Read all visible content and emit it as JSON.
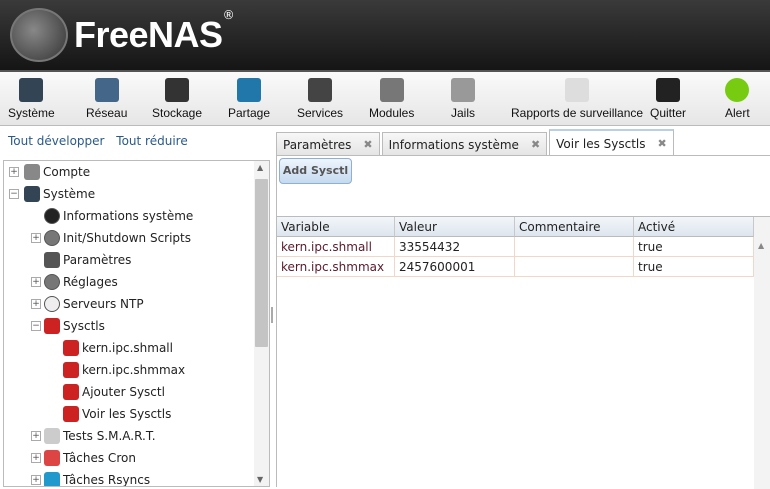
{
  "header": {
    "logo_text": "FreeNAS",
    "logo_mark": "®"
  },
  "toolbar": [
    {
      "label": "Système",
      "icon": "system-icon"
    },
    {
      "label": "Réseau",
      "icon": "network-icon"
    },
    {
      "label": "Stockage",
      "icon": "storage-icon"
    },
    {
      "label": "Partage",
      "icon": "sharing-icon"
    },
    {
      "label": "Services",
      "icon": "services-icon"
    },
    {
      "label": "Modules",
      "icon": "plugins-icon"
    },
    {
      "label": "Jails",
      "icon": "jails-icon"
    },
    {
      "label": "Rapports de surveillance",
      "icon": "reports-icon"
    },
    {
      "label": "Quitter",
      "icon": "logout-icon"
    },
    {
      "label": "Alert",
      "icon": "alert-icon"
    }
  ],
  "links": {
    "expand_all": "Tout développer",
    "collapse_all": "Tout réduire"
  },
  "tree": [
    {
      "label": "Compte",
      "level": 0,
      "toggle": "+",
      "icon": "users-icon"
    },
    {
      "label": "Système",
      "level": 0,
      "toggle": "−",
      "icon": "system-icon"
    },
    {
      "label": "Informations système",
      "level": 1,
      "toggle": "",
      "icon": "info-icon"
    },
    {
      "label": "Init/Shutdown Scripts",
      "level": 1,
      "toggle": "+",
      "icon": "gear-icon"
    },
    {
      "label": "Paramètres",
      "level": 1,
      "toggle": "",
      "icon": "wrench-icon"
    },
    {
      "label": "Réglages",
      "level": 1,
      "toggle": "+",
      "icon": "gear-icon"
    },
    {
      "label": "Serveurs NTP",
      "level": 1,
      "toggle": "+",
      "icon": "clock-icon"
    },
    {
      "label": "Sysctls",
      "level": 1,
      "toggle": "−",
      "icon": "sysctl-icon"
    },
    {
      "label": "kern.ipc.shmall",
      "level": 2,
      "toggle": "",
      "icon": "sysctl-icon"
    },
    {
      "label": "kern.ipc.shmmax",
      "level": 2,
      "toggle": "",
      "icon": "sysctl-icon"
    },
    {
      "label": "Ajouter Sysctl",
      "level": 2,
      "toggle": "",
      "icon": "sysctl-add-icon"
    },
    {
      "label": "Voir les Sysctls",
      "level": 2,
      "toggle": "",
      "icon": "sysctl-view-icon"
    },
    {
      "label": "Tests S.M.A.R.T.",
      "level": 1,
      "toggle": "+",
      "icon": "disk-icon"
    },
    {
      "label": "Tâches Cron",
      "level": 1,
      "toggle": "+",
      "icon": "calendar-icon"
    },
    {
      "label": "Tâches Rsyncs",
      "level": 1,
      "toggle": "+",
      "icon": "sync-icon"
    }
  ],
  "tabs": [
    {
      "label": "Paramètres",
      "active": false
    },
    {
      "label": "Informations système",
      "active": false
    },
    {
      "label": "Voir les Sysctls",
      "active": true
    }
  ],
  "add_button": "Add Sysctl",
  "grid": {
    "columns": [
      "Variable",
      "Valeur",
      "Commentaire",
      "Activé"
    ],
    "rows": [
      [
        "kern.ipc.shmall",
        "33554432",
        "",
        "true"
      ],
      [
        "kern.ipc.shmmax",
        "2457600001",
        "",
        "true"
      ]
    ]
  }
}
